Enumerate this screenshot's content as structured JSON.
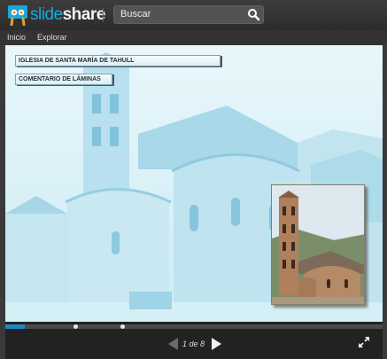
{
  "header": {
    "brand_part1": "slide",
    "brand_part2": "share",
    "search_placeholder": "Buscar",
    "icons": [
      "slideshare-logo-icon",
      "search-icon"
    ]
  },
  "nav": {
    "items": [
      "Inicio",
      "Explorar"
    ]
  },
  "slide": {
    "title": "IGLESIA DE SANTA MARÍA DE  TAHULL",
    "subtitle": "COMENTARIO DE LÁMINAS"
  },
  "player": {
    "page_current": "1",
    "page_sep": " de ",
    "page_total": "8",
    "progress": 0.125,
    "icons": [
      "prev-icon",
      "next-icon",
      "fullscreen-icon"
    ]
  },
  "colors": {
    "accent": "#1aa7d9",
    "progress": "#2087c2",
    "slide_tint": "#d9f1f8"
  }
}
